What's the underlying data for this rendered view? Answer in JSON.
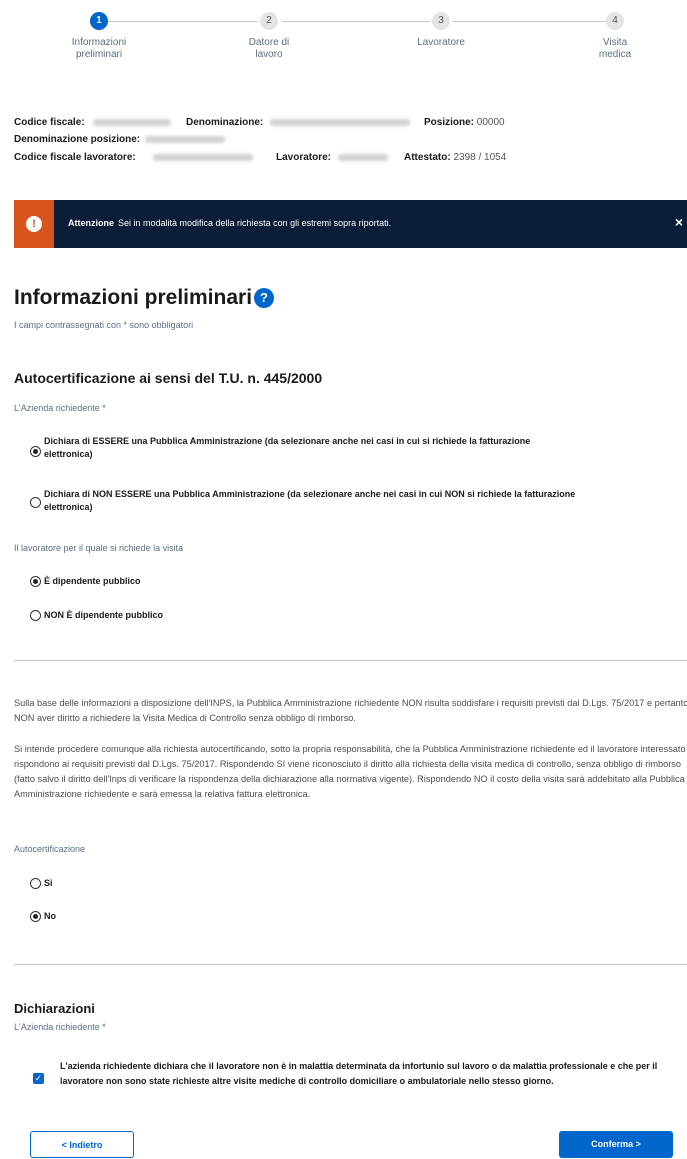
{
  "stepper": [
    {
      "number": "1",
      "label_line1": "Informazioni",
      "label_line2": "preliminari",
      "active": true
    },
    {
      "number": "2",
      "label_line1": "Datore di",
      "label_line2": "lavoro",
      "active": false
    },
    {
      "number": "3",
      "label_line1": "Lavoratore",
      "label_line2": "",
      "active": false
    },
    {
      "number": "4",
      "label_line1": "Visita",
      "label_line2": "medica",
      "active": false
    }
  ],
  "info": {
    "codice_fiscale_label": "Codice fiscale:",
    "denominazione_label": "Denominazione:",
    "posizione_label": "Posizione:",
    "posizione_value": "00000",
    "denominazione_posizione_label": "Denominazione posizione:",
    "codice_fiscale_lavoratore_label": "Codice fiscale lavoratore:",
    "lavoratore_label": "Lavoratore:",
    "attestato_label": "Attestato:",
    "attestato_value": "2398 / 1054"
  },
  "alert": {
    "title": "Attenzione",
    "text": "Sei in modalità modifica della richiesta con gli estremi sopra riportati.",
    "close": "×",
    "icon": "exclamation-icon"
  },
  "page_title": "Informazioni preliminari",
  "help_icon": "?",
  "required_note": "I campi contrassegnati con * sono obbligatori",
  "autocert_section": {
    "title": "Autocertificazione ai sensi del T.U. n. 445/2000",
    "azienda_label": "L'Azienda richiedente *",
    "option_pa_line1": "Dichiara di ESSERE una Pubblica Amministrazione (da selezionare anche nei casi in cui si richiede la fatturazione",
    "option_pa_line2": "elettronica)",
    "option_non_pa_line1": "Dichiara di NON ESSERE una Pubblica Amministrazione (da selezionare anche nei casi in cui NON si richiede la fatturazione",
    "option_non_pa_line2": "elettronica)",
    "lavoratore_label": "Il lavoratore per il quale si richiede la visita",
    "option_pubblico": "È dipendente pubblico",
    "option_non_pubblico": "NON È dipendente pubblico"
  },
  "inps_text": {
    "para1": "Sulla base delle informazioni a disposizione dell'INPS, la Pubblica Amministrazione richiedente NON risulta soddisfare i requisiti previsti dal D.Lgs. 75/2017 e pertanto NON aver diritto a richiedere la Visita Medica di Controllo senza obbligo di rimborso.",
    "para2": "Si intende procedere comunque alla richiesta autocertificando, sotto la propria responsabilità, che la Pubblica Amministrazione richiedente ed il lavoratore interessato rispondono ai requisiti previsti dal D.Lgs. 75/2017. Rispondendo SI viene riconosciuto il diritto alla richiesta della visita medica di controllo, senza obbligo di rimborso (fatto salvo il diritto dell'Inps di verificare la rispondenza della dichiarazione alla normativa vigente). Rispondendo NO il costo della visita sarà addebitato alla Pubblica Amministrazione richiedente e sarà emessa la relativa fattura elettronica.",
    "autocert_label": "Autocertificazione",
    "option_si": "Si",
    "option_no": "No"
  },
  "dichiarazioni": {
    "title": "Dichiarazioni",
    "azienda_label": "L'Azienda richiedente *",
    "checkbox_text": "L'azienda richiedente dichiara che il lavoratore non è in malattia determinata da infortunio sul lavoro o da malattia professionale e che per il lavoratore non sono state richieste altre visite mediche di controllo domiciliare o ambulatoriale nello stesso giorno."
  },
  "buttons": {
    "back": "< Indietro",
    "confirm": "Conferma >"
  }
}
